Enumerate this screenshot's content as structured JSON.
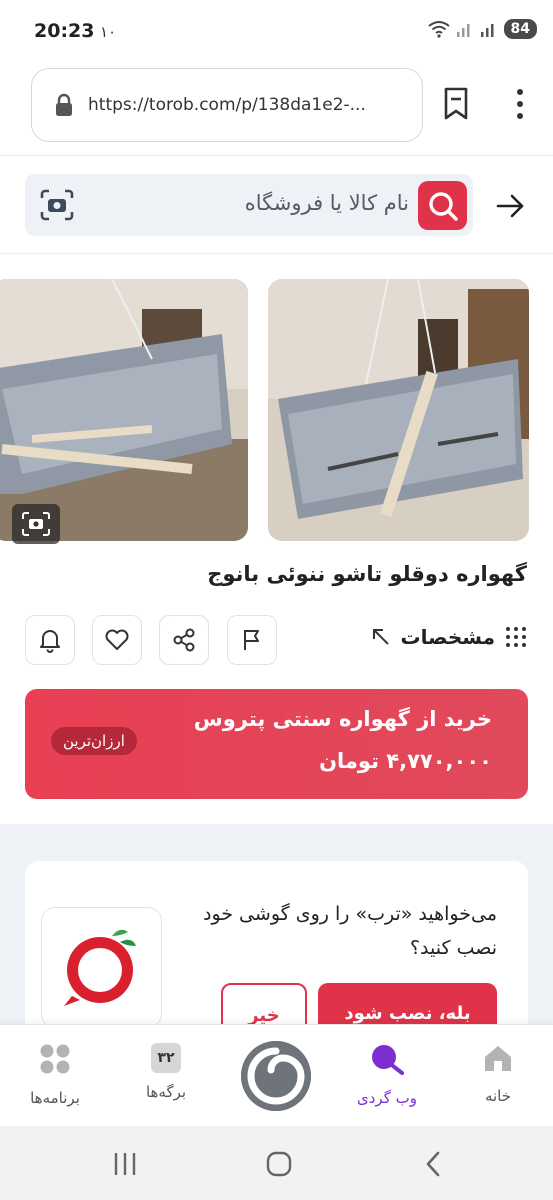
{
  "status_bar": {
    "time": "20:23",
    "notification": "١٠",
    "battery": "84"
  },
  "browser": {
    "url": "https://torob.com/p/138da1e2-..."
  },
  "search": {
    "placeholder": "نام کالا یا فروشگاه"
  },
  "product": {
    "title": "گهواره دوقلو تاشو ننوئی بانوج",
    "specs_label": "مشخصات"
  },
  "buy": {
    "line1": "خرید از گهواره سنتی پتروس",
    "price": "۴,۷۷۰,۰۰۰ تومان",
    "badge": "ارزان‌ترین"
  },
  "install_prompt": {
    "text": "می‌خواهید «ترب» را روی گوشی خود نصب کنید؟",
    "yes_label": "بله، نصب شود",
    "no_label": "خیر"
  },
  "bottom_nav": {
    "items": [
      {
        "label": "خانه",
        "icon": "home-icon"
      },
      {
        "label": "وب گردی",
        "icon": "web-search-icon"
      },
      {
        "label": "برگه‌ها",
        "icon": "tabs-icon",
        "count": "۳۲"
      },
      {
        "label": "برنامه‌ها",
        "icon": "apps-icon"
      }
    ],
    "active": "وب گردی"
  },
  "colors": {
    "brand_red": "#e0334a",
    "active_purple": "#7b2fd0"
  }
}
